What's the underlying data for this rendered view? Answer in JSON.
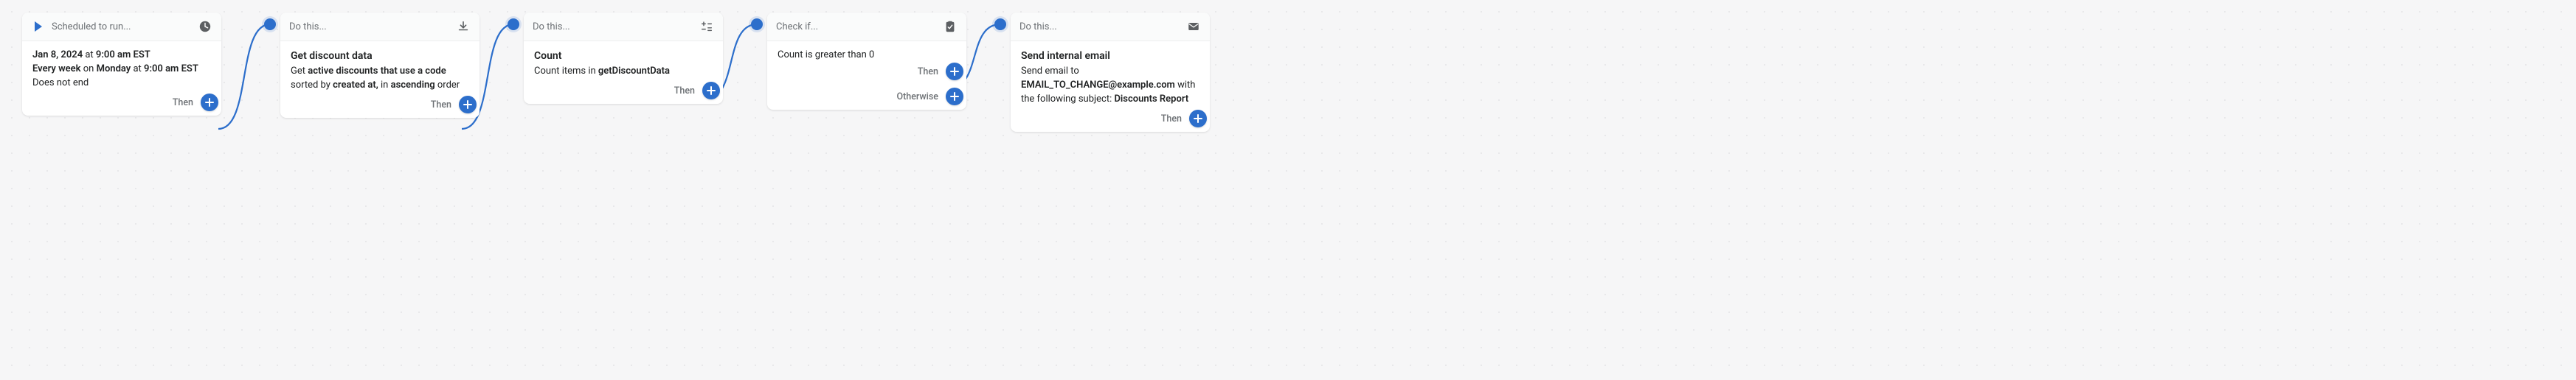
{
  "colors": {
    "accent": "#2c6ecb",
    "muted": "#6d7175",
    "text": "#202223"
  },
  "nodes": {
    "trigger": {
      "header": "Scheduled to run...",
      "date_prefix": "Jan 8, 2024",
      "date_middle": " at ",
      "date_time": "9:00 am EST",
      "recur_prefix": "Every week",
      "recur_middle": " on ",
      "recur_day": "Monday",
      "recur_at": " at ",
      "recur_time": "9:00 am EST",
      "end_line": "Does not end",
      "then": "Then"
    },
    "getData": {
      "header": "Do this...",
      "title": "Get discount data",
      "pre": "Get ",
      "cond": "active discounts that use a code",
      "mid": " sorted by ",
      "sort_field": "created at,",
      "mid2": " in ",
      "order": "ascending",
      "post": " order",
      "then": "Then"
    },
    "count": {
      "header": "Do this...",
      "title": "Count",
      "pre": "Count items in ",
      "ref": "getDiscountData",
      "then": "Then"
    },
    "check": {
      "header": "Check if...",
      "body": "Count is greater than 0",
      "then": "Then",
      "otherwise": "Otherwise"
    },
    "email": {
      "header": "Do this...",
      "title": "Send internal email",
      "pre": "Send email to ",
      "to": "EMAIL_TO_CHANGE@example.com",
      "mid": " with the following subject: ",
      "subject": "Discounts Report",
      "then": "Then"
    }
  }
}
